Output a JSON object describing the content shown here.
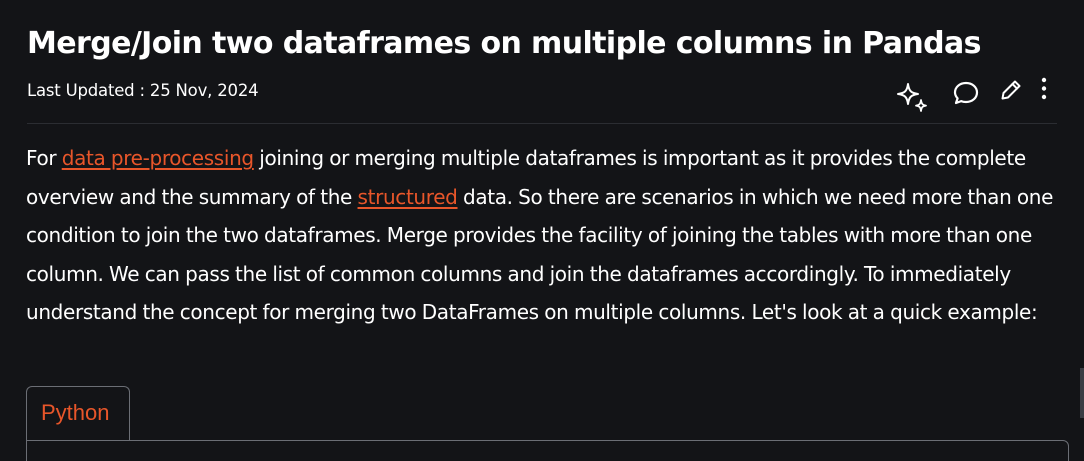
{
  "article": {
    "title": "Merge/Join two dataframes on multiple columns in Pandas",
    "last_updated": "Last Updated : 25 Nov, 2024",
    "actions": [
      {
        "icon": "sparkle-icon",
        "name": "ai-assist"
      },
      {
        "icon": "comment-icon",
        "name": "comment"
      },
      {
        "icon": "pencil-icon",
        "name": "edit"
      },
      {
        "icon": "more-vertical-icon",
        "name": "more-options"
      }
    ],
    "paragraph": {
      "t1": "For ",
      "link1": "data pre-processing",
      "t2": " joining or merging multiple dataframes is important as it provides the complete overview and the summary of the ",
      "link2": "structured",
      "t3": " data. So there are scenarios in which we need more than one condition to join the two dataframes. Merge provides the facility of joining the tables with more than one column. We can pass the list of common columns and join the dataframes accordingly. To immediately understand the concept for merging two DataFrames on multiple columns. Let's look at a quick example:"
    },
    "code_tab": {
      "label": "Python"
    }
  },
  "colors": {
    "background": "#131417",
    "text": "#ffffff",
    "link": "#e8562a",
    "border": "#6b6e75"
  }
}
